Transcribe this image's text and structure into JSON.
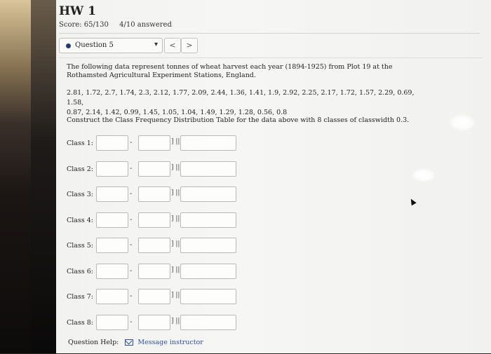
{
  "header": {
    "title": "HW 1",
    "score": "Score: 65/130",
    "answered": "4/10 answered"
  },
  "question_nav": {
    "selected": "Question 5",
    "prev_label": "<",
    "next_label": ">"
  },
  "problem": {
    "intro": "The following data represent tonnes of wheat harvest each year (1894-1925) from Plot 19 at the Rothamsted Agricultural Experiment Stations, England.",
    "data_line_1": "2.81, 1.72, 2.7, 1.74, 2.3, 2.12, 1.77, 2.09, 2.44, 1.36, 1.41, 1.9, 2.92, 2.25, 2.17, 1.72, 1.57, 2.29, 0.69, 1.58,",
    "data_line_2": "0.87, 2.14, 1.42, 0.99, 1.45, 1.05, 1.04, 1.49, 1.29, 1.28, 0.56, 0.8",
    "instruction": "Construct the Class Frequency Distribution Table for the data above with 8 classes of classwidth 0.3."
  },
  "classes": [
    {
      "label": "Class 1:",
      "lower": "",
      "upper": "",
      "frequency": ""
    },
    {
      "label": "Class 2:",
      "lower": "",
      "upper": "",
      "frequency": ""
    },
    {
      "label": "Class 3:",
      "lower": "",
      "upper": "",
      "frequency": ""
    },
    {
      "label": "Class 4:",
      "lower": "",
      "upper": "",
      "frequency": ""
    },
    {
      "label": "Class 5:",
      "lower": "",
      "upper": "",
      "frequency": ""
    },
    {
      "label": "Class 6:",
      "lower": "",
      "upper": "",
      "frequency": ""
    },
    {
      "label": "Class 7:",
      "lower": "",
      "upper": "",
      "frequency": ""
    },
    {
      "label": "Class 8:",
      "lower": "",
      "upper": "",
      "frequency": ""
    }
  ],
  "separators": {
    "dash": "-",
    "bracket": "] ||"
  },
  "help": {
    "label": "Question Help:",
    "link_text": "Message instructor"
  },
  "icons": {
    "question_dot": "status-dot-icon",
    "dropdown": "chevron-down-icon",
    "mail": "mail-icon"
  },
  "colors": {
    "status_dot": "#1f3b78",
    "link": "#2d4fa0"
  }
}
